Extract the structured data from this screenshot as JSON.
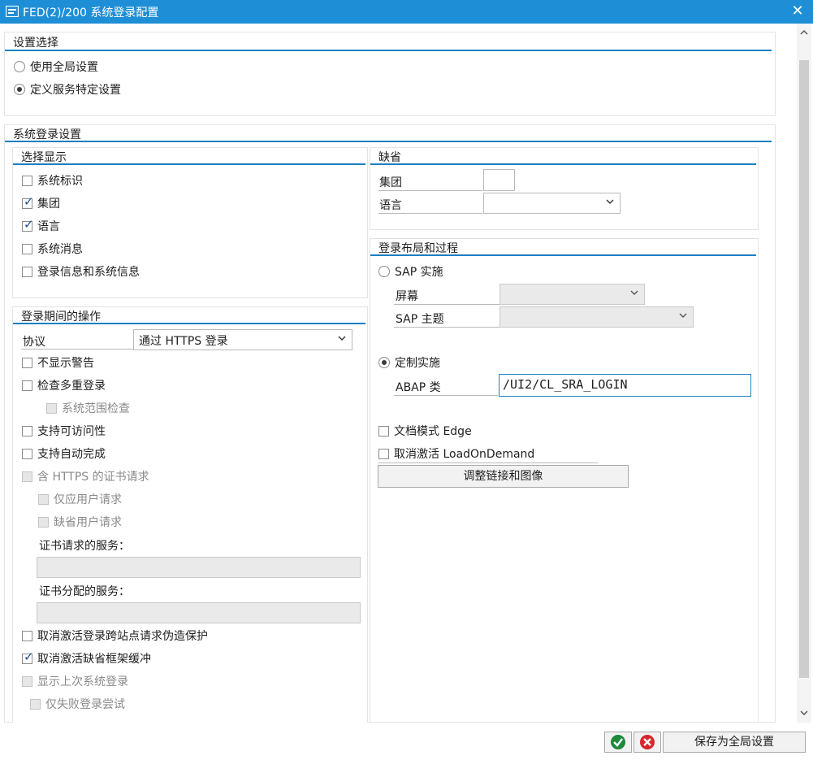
{
  "window": {
    "title": "FED(2)/200 系统登录配置",
    "close_icon": "close-icon",
    "app_icon": "sap-window-icon"
  },
  "settings_selection": {
    "title": "设置选择",
    "options": [
      {
        "label": "使用全局设置",
        "selected": false
      },
      {
        "label": "定义服务特定设置",
        "selected": true
      }
    ]
  },
  "system_login": {
    "title": "系统登录设置",
    "display_selection": {
      "title": "选择显示",
      "items": [
        {
          "label": "系统标识",
          "checked": false
        },
        {
          "label": "集团",
          "checked": true
        },
        {
          "label": "语言",
          "checked": true
        },
        {
          "label": "系统消息",
          "checked": false
        },
        {
          "label": "登录信息和系统信息",
          "checked": false
        }
      ]
    },
    "defaults": {
      "title": "缺省",
      "client_label": "集团",
      "client_value": "",
      "language_label": "语言",
      "language_value": ""
    },
    "login_ops": {
      "title": "登录期间的操作",
      "protocol_label": "协议",
      "protocol_value": "通过 HTTPS 登录",
      "no_warning": "不显示警告",
      "check_multi": "检查多重登录",
      "system_wide": "系统范围检查",
      "accessibility": "支持可访问性",
      "autocomplete": "支持自动完成",
      "cert_https": "含 HTTPS 的证书请求",
      "only_user": "仅应用户请求",
      "default_user": "缺省用户请求",
      "cert_service_label": "证书请求的服务：",
      "cert_service_value": "",
      "cert_assign_label": "证书分配的服务：",
      "cert_assign_value": "",
      "disable_xsrf": "取消激活登录跨站点请求伪造保护",
      "disable_frame": "取消激活缺省框架缓冲",
      "show_last": "显示上次系统登录",
      "only_failed": "仅失败登录尝试"
    },
    "layout": {
      "title": "登录布局和过程",
      "sap_impl": "SAP 实施",
      "screen_label": "屏幕",
      "screen_value": "",
      "theme_label": "SAP 主题",
      "theme_value": "",
      "custom_impl": "定制实施",
      "abap_label": "ABAP 类",
      "abap_value": "/UI2/CL_SRA_LOGIN",
      "edge_mode": "文档模式 Edge",
      "disable_lod": "取消激活 LoadOnDemand",
      "adjust_button": "调整链接和图像"
    }
  },
  "footer": {
    "save_global": "保存为全局设置",
    "ok_icon": "check-icon",
    "cancel_icon": "cancel-icon"
  }
}
